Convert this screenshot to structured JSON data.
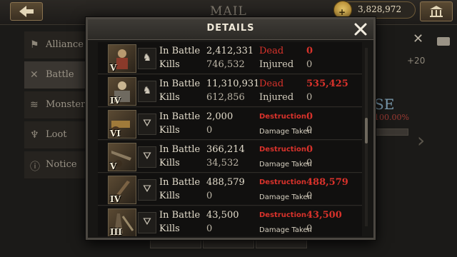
{
  "header": {
    "title": "MAIL",
    "gold_amount": "3,828,972"
  },
  "sidebar": {
    "items": [
      {
        "label": "Alliance",
        "icon": "alliance-icon"
      },
      {
        "label": "Battle",
        "icon": "battle-icon"
      },
      {
        "label": "Monster",
        "icon": "monster-icon"
      },
      {
        "label": "Loot",
        "icon": "loot-icon"
      },
      {
        "label": "Notice",
        "icon": "notice-icon"
      }
    ]
  },
  "background": {
    "bonus": "+20",
    "banner_text": "SE",
    "percent": "100.00%"
  },
  "modal": {
    "title": "DETAILS",
    "rows": [
      {
        "tier": "V",
        "type_icon": "cavalry-icon",
        "label1": "In Battle",
        "value1": "2,412,331",
        "label2": "Kills",
        "value2": "746,532",
        "stat1_label": "Dead",
        "stat1_value": "0",
        "stat2_label": "Injured",
        "stat2_value": "0",
        "kind": "troop"
      },
      {
        "tier": "IV",
        "type_icon": "cavalry-icon",
        "label1": "In Battle",
        "value1": "11,310,931",
        "label2": "Kills",
        "value2": "612,856",
        "stat1_label": "Dead",
        "stat1_value": "535,425",
        "stat2_label": "Injured",
        "stat2_value": "0",
        "kind": "troop"
      },
      {
        "tier": "VI",
        "type_icon": "siege-icon",
        "label1": "In Battle",
        "value1": "2,000",
        "label2": "Kills",
        "value2": "0",
        "stat1_label": "Destruction",
        "stat1_value": "0",
        "stat2_label": "Damage Taken",
        "stat2_value": "0",
        "kind": "siege"
      },
      {
        "tier": "V",
        "type_icon": "siege-icon",
        "label1": "In Battle",
        "value1": "366,214",
        "label2": "Kills",
        "value2": "34,532",
        "stat1_label": "Destruction",
        "stat1_value": "0",
        "stat2_label": "Damage Taken",
        "stat2_value": "0",
        "kind": "siege"
      },
      {
        "tier": "IV",
        "type_icon": "siege-icon",
        "label1": "In Battle",
        "value1": "488,579",
        "label2": "Kills",
        "value2": "0",
        "stat1_label": "Destruction",
        "stat1_value": "488,579",
        "stat2_label": "Damage Taken",
        "stat2_value": "0",
        "kind": "siege"
      },
      {
        "tier": "III",
        "type_icon": "siege-icon",
        "label1": "In Battle",
        "value1": "43,500",
        "label2": "Kills",
        "value2": "0",
        "stat1_label": "Destruction",
        "stat1_value": "43,500",
        "stat2_label": "Damage Taken",
        "stat2_value": "0",
        "kind": "siege"
      }
    ]
  },
  "colors": {
    "accent_red": "#d8322b",
    "panel_bg": "#171614",
    "frame": "#4b4741"
  }
}
